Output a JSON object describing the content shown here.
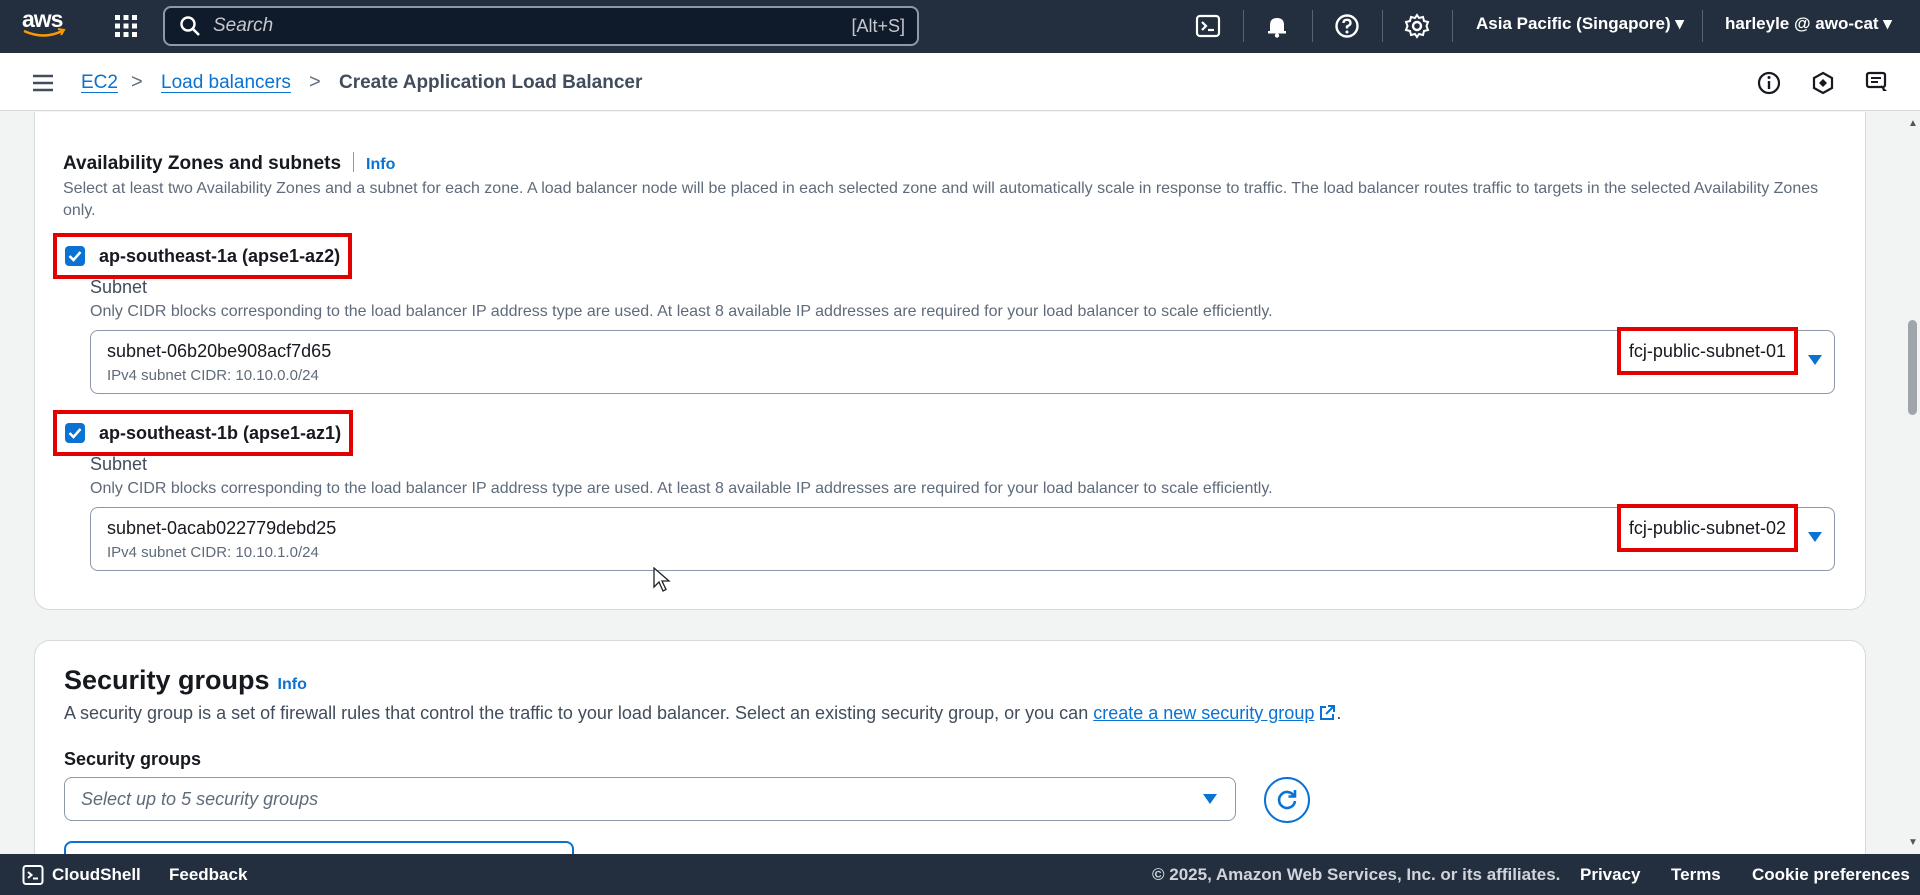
{
  "topnav": {
    "logo_text": "aws",
    "search": {
      "placeholder": "Search",
      "shortcut": "[Alt+S]"
    },
    "region": "Asia Pacific (Singapore) ▾",
    "user": "harleyle @ awo-cat ▾"
  },
  "breadcrumb": {
    "items": [
      "EC2",
      "Load balancers",
      "Create Application Load Balancer"
    ],
    "separator": ">"
  },
  "az_section": {
    "title": "Availability Zones and subnets",
    "info": "Info",
    "description": "Select at least two Availability Zones and a subnet for each zone. A load balancer node will be placed in each selected zone and will automatically scale in response to traffic. The load balancer routes traffic to targets in the selected Availability Zones only.",
    "zones": [
      {
        "label": "ap-southeast-1a (apse1-az2)",
        "checked": true,
        "subnet_label": "Subnet",
        "subnet_desc": "Only CIDR blocks corresponding to the load balancer IP address type are used. At least 8 available IP addresses are required for your load balancer to scale efficiently.",
        "subnet_id": "subnet-06b20be908acf7d65",
        "subnet_cidr": "IPv4 subnet CIDR: 10.10.0.0/24",
        "subnet_name": "fcj-public-subnet-01"
      },
      {
        "label": "ap-southeast-1b (apse1-az1)",
        "checked": true,
        "subnet_label": "Subnet",
        "subnet_desc": "Only CIDR blocks corresponding to the load balancer IP address type are used. At least 8 available IP addresses are required for your load balancer to scale efficiently.",
        "subnet_id": "subnet-0acab022779debd25",
        "subnet_cidr": "IPv4 subnet CIDR: 10.10.1.0/24",
        "subnet_name": "fcj-public-subnet-02"
      }
    ]
  },
  "sg_section": {
    "title": "Security groups",
    "info": "Info",
    "description": "A security group is a set of firewall rules that control the traffic to your load balancer. Select an existing security group, or you can",
    "create_link": "create a new security group",
    "period": ".",
    "field_label": "Security groups",
    "placeholder": "Select up to 5 security groups"
  },
  "footer": {
    "cloudshell": "CloudShell",
    "feedback": "Feedback",
    "copyright": "© 2025, Amazon Web Services, Inc. or its affiliates.",
    "privacy": "Privacy",
    "terms": "Terms",
    "cookies": "Cookie preferences"
  },
  "colors": {
    "nav_bg": "#232f3e",
    "link": "#0972d3",
    "highlight": "#e30000"
  }
}
